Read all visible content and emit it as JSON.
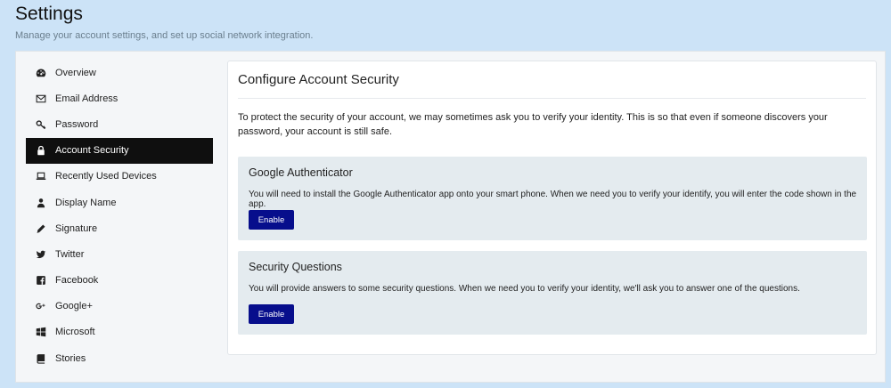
{
  "header": {
    "title": "Settings",
    "subtitle": "Manage your account settings, and set up social network integration."
  },
  "sidebar": {
    "items": [
      {
        "label": "Overview",
        "icon": "dashboard-icon"
      },
      {
        "label": "Email Address",
        "icon": "envelope-icon"
      },
      {
        "label": "Password",
        "icon": "key-icon"
      },
      {
        "label": "Account Security",
        "icon": "lock-icon",
        "active": true
      },
      {
        "label": "Recently Used Devices",
        "icon": "laptop-icon"
      },
      {
        "label": "Display Name",
        "icon": "user-icon"
      },
      {
        "label": "Signature",
        "icon": "pencil-icon"
      },
      {
        "label": "Twitter",
        "icon": "twitter-icon"
      },
      {
        "label": "Facebook",
        "icon": "facebook-icon"
      },
      {
        "label": "Google+",
        "icon": "google-plus-icon"
      },
      {
        "label": "Microsoft",
        "icon": "windows-icon"
      },
      {
        "label": "Stories",
        "icon": "book-icon"
      }
    ]
  },
  "content": {
    "title": "Configure Account Security",
    "intro": "To protect the security of your account, we may sometimes ask you to verify your identity. This is so that even if someone discovers your password, your account is still safe.",
    "panels": [
      {
        "title": "Google Authenticator",
        "text": "You will need to install the Google Authenticator app onto your smart phone. When we need you to verify your identify, you will enter the code shown in the app.",
        "button": "Enable"
      },
      {
        "title": "Security Questions",
        "text": "You will provide answers to some security questions. When we need you to verify your identity, we'll ask you to answer one of the questions.",
        "button": "Enable"
      }
    ]
  },
  "colors": {
    "page_background": "#cce3f7",
    "active_item": "#0f0f0f",
    "button": "#070e8c",
    "panel": "#e4ebef"
  }
}
